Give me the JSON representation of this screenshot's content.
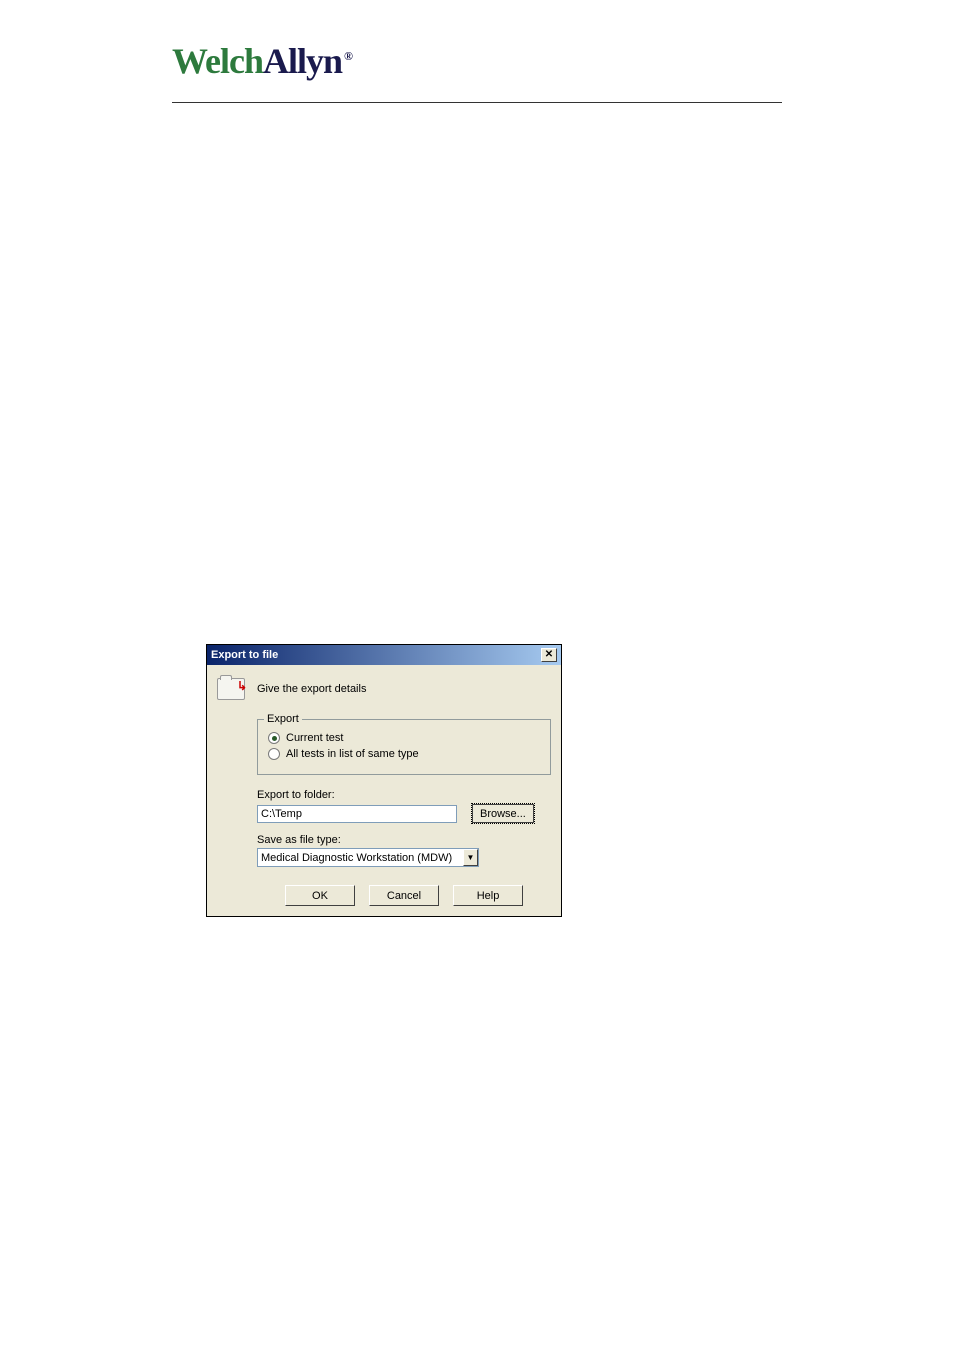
{
  "logo": {
    "part1": "Welch",
    "part2": "Allyn",
    "registered": "®"
  },
  "dialog": {
    "title": "Export to file",
    "subtitle": "Give the export details",
    "fieldset": {
      "legend": "Export",
      "radio_current": "Current test",
      "radio_all": "All tests in list of same type"
    },
    "folder": {
      "label": "Export to folder:",
      "value": "C:\\Temp",
      "browse": "Browse..."
    },
    "filetype": {
      "label": "Save as file type:",
      "value": "Medical Diagnostic Workstation (MDW)"
    },
    "buttons": {
      "ok": "OK",
      "cancel": "Cancel",
      "help": "Help"
    }
  }
}
